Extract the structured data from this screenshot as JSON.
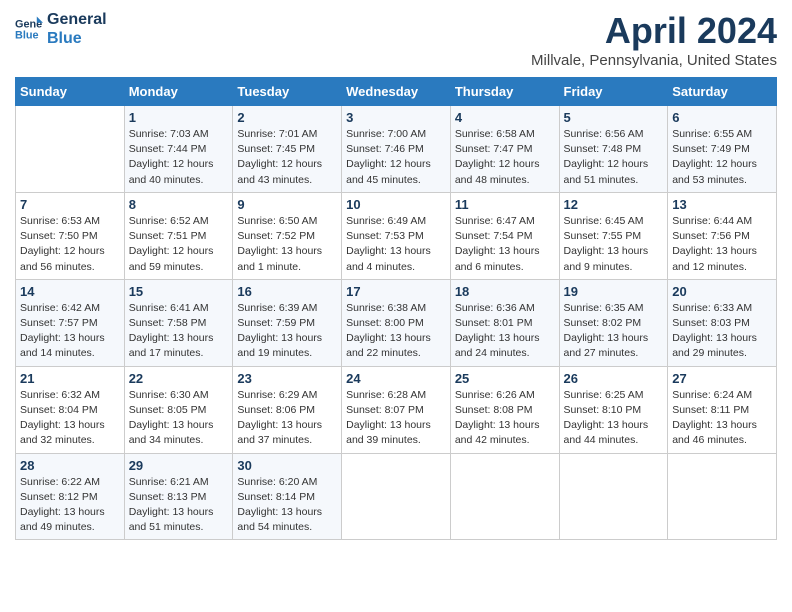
{
  "logo": {
    "line1": "General",
    "line2": "Blue"
  },
  "title": "April 2024",
  "subtitle": "Millvale, Pennsylvania, United States",
  "days_of_week": [
    "Sunday",
    "Monday",
    "Tuesday",
    "Wednesday",
    "Thursday",
    "Friday",
    "Saturday"
  ],
  "weeks": [
    [
      {
        "num": "",
        "sunrise": "",
        "sunset": "",
        "daylight": ""
      },
      {
        "num": "1",
        "sunrise": "Sunrise: 7:03 AM",
        "sunset": "Sunset: 7:44 PM",
        "daylight": "Daylight: 12 hours and 40 minutes."
      },
      {
        "num": "2",
        "sunrise": "Sunrise: 7:01 AM",
        "sunset": "Sunset: 7:45 PM",
        "daylight": "Daylight: 12 hours and 43 minutes."
      },
      {
        "num": "3",
        "sunrise": "Sunrise: 7:00 AM",
        "sunset": "Sunset: 7:46 PM",
        "daylight": "Daylight: 12 hours and 45 minutes."
      },
      {
        "num": "4",
        "sunrise": "Sunrise: 6:58 AM",
        "sunset": "Sunset: 7:47 PM",
        "daylight": "Daylight: 12 hours and 48 minutes."
      },
      {
        "num": "5",
        "sunrise": "Sunrise: 6:56 AM",
        "sunset": "Sunset: 7:48 PM",
        "daylight": "Daylight: 12 hours and 51 minutes."
      },
      {
        "num": "6",
        "sunrise": "Sunrise: 6:55 AM",
        "sunset": "Sunset: 7:49 PM",
        "daylight": "Daylight: 12 hours and 53 minutes."
      }
    ],
    [
      {
        "num": "7",
        "sunrise": "Sunrise: 6:53 AM",
        "sunset": "Sunset: 7:50 PM",
        "daylight": "Daylight: 12 hours and 56 minutes."
      },
      {
        "num": "8",
        "sunrise": "Sunrise: 6:52 AM",
        "sunset": "Sunset: 7:51 PM",
        "daylight": "Daylight: 12 hours and 59 minutes."
      },
      {
        "num": "9",
        "sunrise": "Sunrise: 6:50 AM",
        "sunset": "Sunset: 7:52 PM",
        "daylight": "Daylight: 13 hours and 1 minute."
      },
      {
        "num": "10",
        "sunrise": "Sunrise: 6:49 AM",
        "sunset": "Sunset: 7:53 PM",
        "daylight": "Daylight: 13 hours and 4 minutes."
      },
      {
        "num": "11",
        "sunrise": "Sunrise: 6:47 AM",
        "sunset": "Sunset: 7:54 PM",
        "daylight": "Daylight: 13 hours and 6 minutes."
      },
      {
        "num": "12",
        "sunrise": "Sunrise: 6:45 AM",
        "sunset": "Sunset: 7:55 PM",
        "daylight": "Daylight: 13 hours and 9 minutes."
      },
      {
        "num": "13",
        "sunrise": "Sunrise: 6:44 AM",
        "sunset": "Sunset: 7:56 PM",
        "daylight": "Daylight: 13 hours and 12 minutes."
      }
    ],
    [
      {
        "num": "14",
        "sunrise": "Sunrise: 6:42 AM",
        "sunset": "Sunset: 7:57 PM",
        "daylight": "Daylight: 13 hours and 14 minutes."
      },
      {
        "num": "15",
        "sunrise": "Sunrise: 6:41 AM",
        "sunset": "Sunset: 7:58 PM",
        "daylight": "Daylight: 13 hours and 17 minutes."
      },
      {
        "num": "16",
        "sunrise": "Sunrise: 6:39 AM",
        "sunset": "Sunset: 7:59 PM",
        "daylight": "Daylight: 13 hours and 19 minutes."
      },
      {
        "num": "17",
        "sunrise": "Sunrise: 6:38 AM",
        "sunset": "Sunset: 8:00 PM",
        "daylight": "Daylight: 13 hours and 22 minutes."
      },
      {
        "num": "18",
        "sunrise": "Sunrise: 6:36 AM",
        "sunset": "Sunset: 8:01 PM",
        "daylight": "Daylight: 13 hours and 24 minutes."
      },
      {
        "num": "19",
        "sunrise": "Sunrise: 6:35 AM",
        "sunset": "Sunset: 8:02 PM",
        "daylight": "Daylight: 13 hours and 27 minutes."
      },
      {
        "num": "20",
        "sunrise": "Sunrise: 6:33 AM",
        "sunset": "Sunset: 8:03 PM",
        "daylight": "Daylight: 13 hours and 29 minutes."
      }
    ],
    [
      {
        "num": "21",
        "sunrise": "Sunrise: 6:32 AM",
        "sunset": "Sunset: 8:04 PM",
        "daylight": "Daylight: 13 hours and 32 minutes."
      },
      {
        "num": "22",
        "sunrise": "Sunrise: 6:30 AM",
        "sunset": "Sunset: 8:05 PM",
        "daylight": "Daylight: 13 hours and 34 minutes."
      },
      {
        "num": "23",
        "sunrise": "Sunrise: 6:29 AM",
        "sunset": "Sunset: 8:06 PM",
        "daylight": "Daylight: 13 hours and 37 minutes."
      },
      {
        "num": "24",
        "sunrise": "Sunrise: 6:28 AM",
        "sunset": "Sunset: 8:07 PM",
        "daylight": "Daylight: 13 hours and 39 minutes."
      },
      {
        "num": "25",
        "sunrise": "Sunrise: 6:26 AM",
        "sunset": "Sunset: 8:08 PM",
        "daylight": "Daylight: 13 hours and 42 minutes."
      },
      {
        "num": "26",
        "sunrise": "Sunrise: 6:25 AM",
        "sunset": "Sunset: 8:10 PM",
        "daylight": "Daylight: 13 hours and 44 minutes."
      },
      {
        "num": "27",
        "sunrise": "Sunrise: 6:24 AM",
        "sunset": "Sunset: 8:11 PM",
        "daylight": "Daylight: 13 hours and 46 minutes."
      }
    ],
    [
      {
        "num": "28",
        "sunrise": "Sunrise: 6:22 AM",
        "sunset": "Sunset: 8:12 PM",
        "daylight": "Daylight: 13 hours and 49 minutes."
      },
      {
        "num": "29",
        "sunrise": "Sunrise: 6:21 AM",
        "sunset": "Sunset: 8:13 PM",
        "daylight": "Daylight: 13 hours and 51 minutes."
      },
      {
        "num": "30",
        "sunrise": "Sunrise: 6:20 AM",
        "sunset": "Sunset: 8:14 PM",
        "daylight": "Daylight: 13 hours and 54 minutes."
      },
      {
        "num": "",
        "sunrise": "",
        "sunset": "",
        "daylight": ""
      },
      {
        "num": "",
        "sunrise": "",
        "sunset": "",
        "daylight": ""
      },
      {
        "num": "",
        "sunrise": "",
        "sunset": "",
        "daylight": ""
      },
      {
        "num": "",
        "sunrise": "",
        "sunset": "",
        "daylight": ""
      }
    ]
  ]
}
